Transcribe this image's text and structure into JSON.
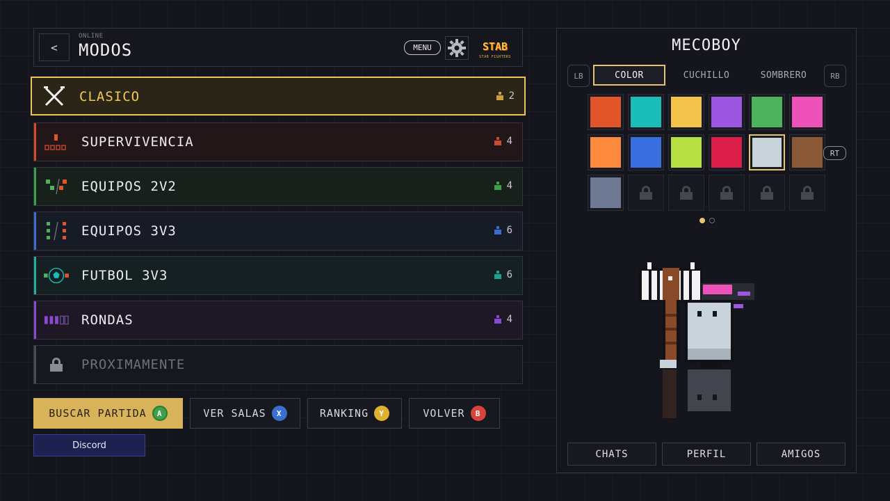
{
  "header": {
    "back_label": "<",
    "subtitle": "ONLINE",
    "title": "MODOS",
    "menu_label": "MENU",
    "logo_text": "STAB",
    "logo_subtext": "STAB FIGHTERS"
  },
  "modes": [
    {
      "label": "CLASICO",
      "count": "2",
      "color": "#eec55a"
    },
    {
      "label": "SUPERVIVENCIA",
      "count": "4",
      "color": "#d84a2a"
    },
    {
      "label": "EQUIPOS 2V2",
      "count": "4",
      "color": "#3fa04a"
    },
    {
      "label": "EQUIPOS 3V3",
      "count": "6",
      "color": "#3a6fd0"
    },
    {
      "label": "FUTBOL 3V3",
      "count": "6",
      "color": "#1fb0a0"
    },
    {
      "label": "RONDAS",
      "count": "4",
      "color": "#8a4ad0"
    },
    {
      "label": "PROXIMAMENTE",
      "count": "",
      "color": "#4a4b56"
    }
  ],
  "actions": {
    "search": {
      "label": "BUSCAR PARTIDA",
      "key": "A",
      "key_color": "#3fa04a"
    },
    "rooms": {
      "label": "VER SALAS",
      "key": "X",
      "key_color": "#3a6fd0"
    },
    "ranking": {
      "label": "RANKING",
      "key": "Y",
      "key_color": "#e0b030"
    },
    "back": {
      "label": "VOLVER",
      "key": "B",
      "key_color": "#d8433a"
    },
    "discord": "Discord"
  },
  "panel": {
    "player_name": "MECOBOY",
    "lb": "LB",
    "rb": "RB",
    "rt": "RT",
    "tabs": [
      "COLOR",
      "CUCHILLO",
      "SOMBRERO"
    ],
    "active_tab": "COLOR",
    "swatches": [
      "#e2552b",
      "#1bbdb9",
      "#f2c24a",
      "#9c57e0",
      "#4db35c",
      "#ec52b8",
      "#fb8a3c",
      "#3a6fe0",
      "#b6e043",
      "#dc1f4a",
      "#c9d3db",
      "#8a5a36",
      "#6e7a94"
    ],
    "selected_swatch": "#c9d3db",
    "locked_slots": 5,
    "page_indicator": {
      "current": 1,
      "total": 2
    },
    "bottom_buttons": [
      "CHATS",
      "PERFIL",
      "AMIGOS"
    ]
  }
}
